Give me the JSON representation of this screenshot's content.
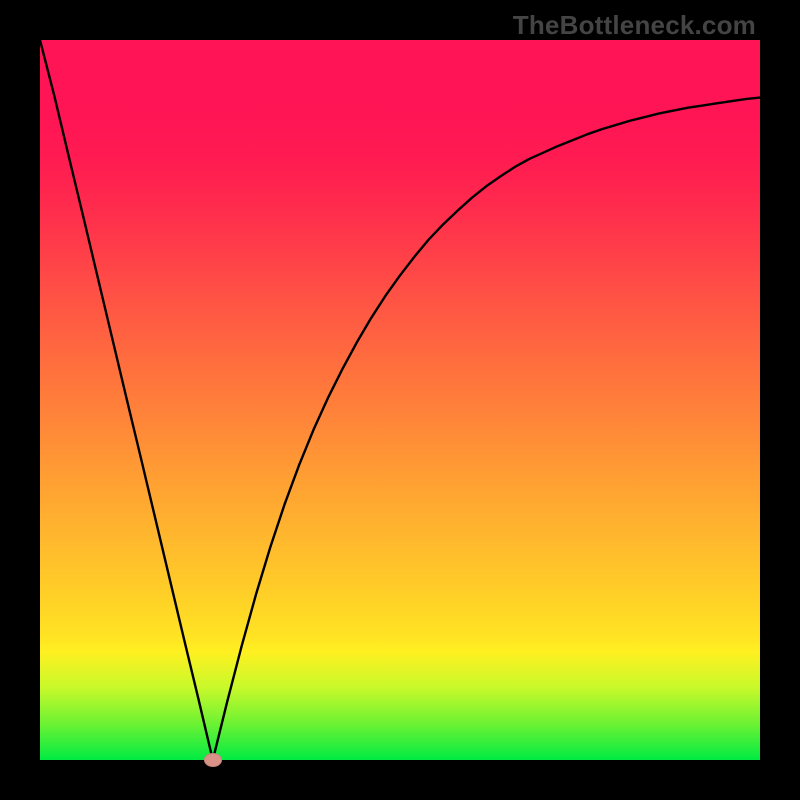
{
  "watermark": "TheBottleneck.com",
  "chart_data": {
    "type": "line",
    "title": "",
    "xlabel": "",
    "ylabel": "",
    "xlim": [
      0,
      100
    ],
    "ylim": [
      0,
      100
    ],
    "grid": false,
    "minimum_point": {
      "x": 24,
      "y": 0
    },
    "series": [
      {
        "name": "curve",
        "x": [
          0,
          2,
          4,
          6,
          8,
          10,
          12,
          14,
          16,
          18,
          20,
          22,
          24,
          26,
          28,
          30,
          32,
          34,
          36,
          38,
          40,
          42,
          44,
          46,
          48,
          50,
          52,
          54,
          56,
          58,
          60,
          62,
          64,
          66,
          68,
          70,
          72,
          74,
          76,
          78,
          80,
          82,
          84,
          86,
          88,
          90,
          92,
          94,
          96,
          98,
          100
        ],
        "y": [
          100,
          92.2,
          83.8,
          75.5,
          67.1,
          58.7,
          50.3,
          42,
          33.6,
          25.2,
          16.8,
          8.5,
          0,
          8.1,
          15.8,
          23,
          29.6,
          35.6,
          41,
          45.9,
          50.3,
          54.3,
          58,
          61.4,
          64.5,
          67.3,
          69.9,
          72.3,
          74.4,
          76.3,
          78.1,
          79.7,
          81.1,
          82.4,
          83.5,
          84.4,
          85.3,
          86.1,
          86.9,
          87.6,
          88.2,
          88.8,
          89.3,
          89.8,
          90.2,
          90.6,
          90.9,
          91.2,
          91.5,
          91.8,
          92
        ]
      }
    ],
    "background_gradient": {
      "direction": "vertical",
      "stops": [
        {
          "pos": 0,
          "color": "#00eb43"
        },
        {
          "pos": 50,
          "color": "#ff8639"
        },
        {
          "pos": 100,
          "color": "#ff1556"
        }
      ]
    }
  }
}
